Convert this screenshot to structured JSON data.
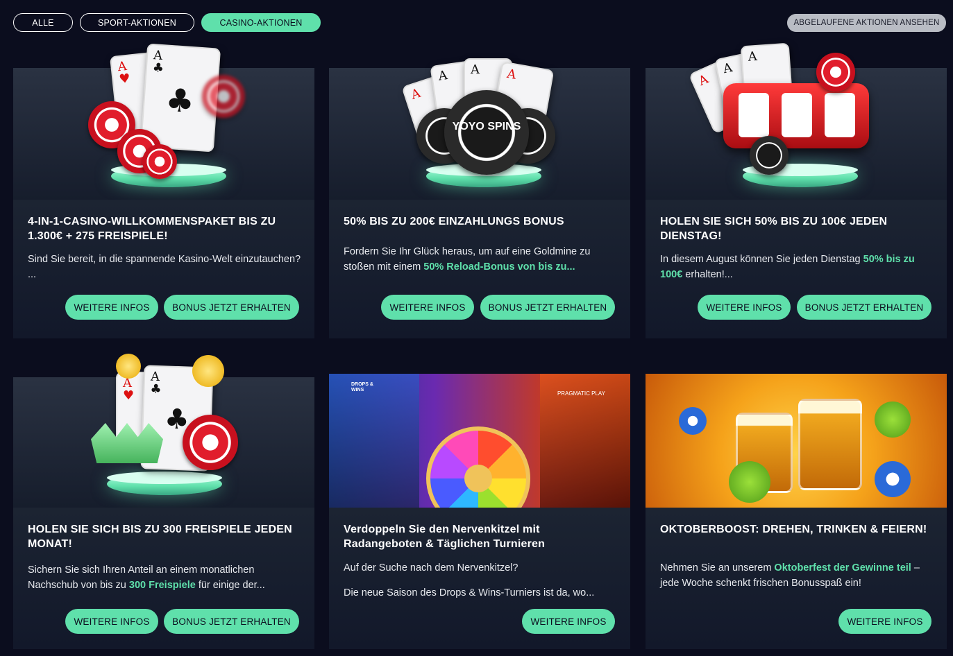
{
  "filters": {
    "all": "ALLE",
    "sport": "SPORT-AKTIONEN",
    "casino": "CASINO-AKTIONEN",
    "expired": "ABGELAUFENE AKTIONEN ANSEHEN"
  },
  "brand": {
    "accent": "#5fe0ab",
    "background": "#0b0d1e",
    "logo_text": "YOYO SPINS"
  },
  "cards": [
    {
      "title": "4-IN-1-CASINO-WILLKOMMENSPAKET BIS ZU 1.300€ + 275 FREISPIELE!",
      "desc_1": "Sind Sie bereit, in die spannende Kasino-Welt einzutauchen? ...",
      "more": "WEITERE INFOS",
      "claim": "BONUS JETZT ERHALTEN"
    },
    {
      "title": "50% BIS ZU 200€ EINZAHLUNGS BONUS",
      "desc_1": "Fordern Sie Ihr Glück heraus, um auf eine Goldmine zu stoßen mit einem ",
      "desc_hl": "50% Reload-Bonus von bis zu...",
      "more": "WEITERE INFOS",
      "claim": "BONUS JETZT ERHALTEN"
    },
    {
      "title": "HOLEN SIE SICH 50% BIS ZU 100€ JEDEN DIENSTAG!",
      "desc_1": "In diesem August können Sie jeden Dienstag ",
      "desc_hl": "50% bis zu 100€",
      "desc_2": " erhalten!...",
      "more": "WEITERE INFOS",
      "claim": "BONUS JETZT ERHALTEN"
    },
    {
      "title": "HOLEN SIE SICH BIS ZU 300 FREISPIELE JEDEN MONAT!",
      "desc_1": "Sichern Sie sich Ihren Anteil an einem monatlichen Nachschub von bis zu ",
      "desc_hl": "300 Freispiele",
      "desc_2": " für einige der...",
      "more": "WEITERE INFOS",
      "claim": "BONUS JETZT ERHALTEN"
    },
    {
      "title": "Verdoppeln Sie den Nervenkitzel mit Radangeboten & Täglichen Turnieren",
      "desc_1": "Auf der Suche nach dem Nervenkitzel?",
      "desc_2": "Die neue Saison des Drops & Wins-Turniers ist da, wo...",
      "badge_left": "DROPS & WINS",
      "badge_right": "PRAGMATIC PLAY",
      "more": "WEITERE INFOS"
    },
    {
      "title": "OKTOBERBOOST: DREHEN, TRINKEN & FEIERN!",
      "desc_1": "Nehmen Sie an unserem ",
      "desc_hl": "Oktoberfest der Gewinne teil",
      "desc_2": " – jede Woche schenkt frischen Bonusspaß ein!",
      "more": "WEITERE INFOS"
    }
  ]
}
